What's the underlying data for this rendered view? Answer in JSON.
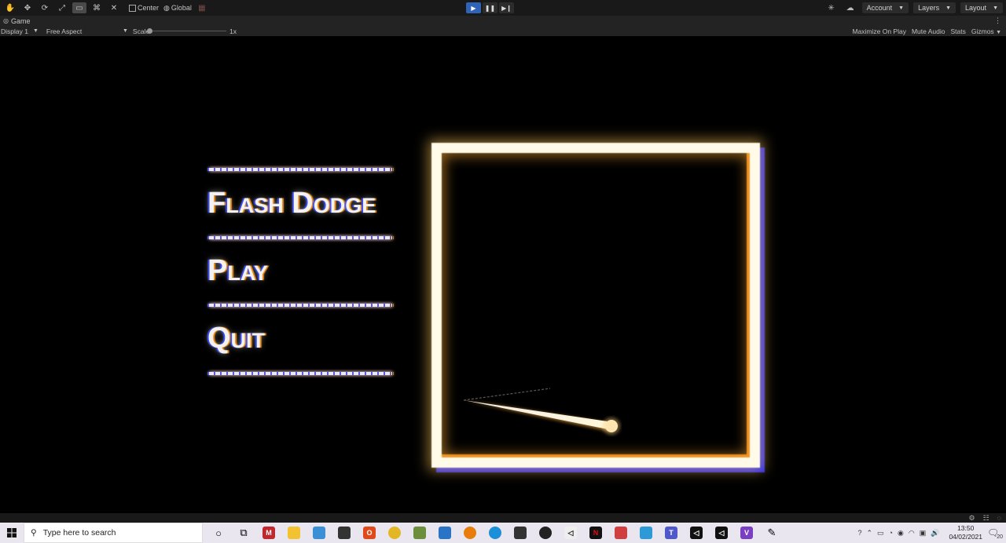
{
  "toolbar": {
    "pivot_label": "Center",
    "space_label": "Global",
    "account_label": "Account",
    "layers_label": "Layers",
    "layout_label": "Layout"
  },
  "game_tab": {
    "title": "Game",
    "display_label": "Display 1",
    "aspect_label": "Free Aspect",
    "scale_label": "Scale",
    "scale_value": "1x",
    "maximize_label": "Maximize On Play",
    "mute_label": "Mute Audio",
    "stats_label": "Stats",
    "gizmos_label": "Gizmos"
  },
  "game": {
    "title": "Flash Dodge",
    "play_label": "Play",
    "quit_label": "Quit"
  },
  "taskbar": {
    "search_placeholder": "Type here to search",
    "time": "13:50",
    "date": "04/02/2021",
    "notification_count": "20"
  }
}
